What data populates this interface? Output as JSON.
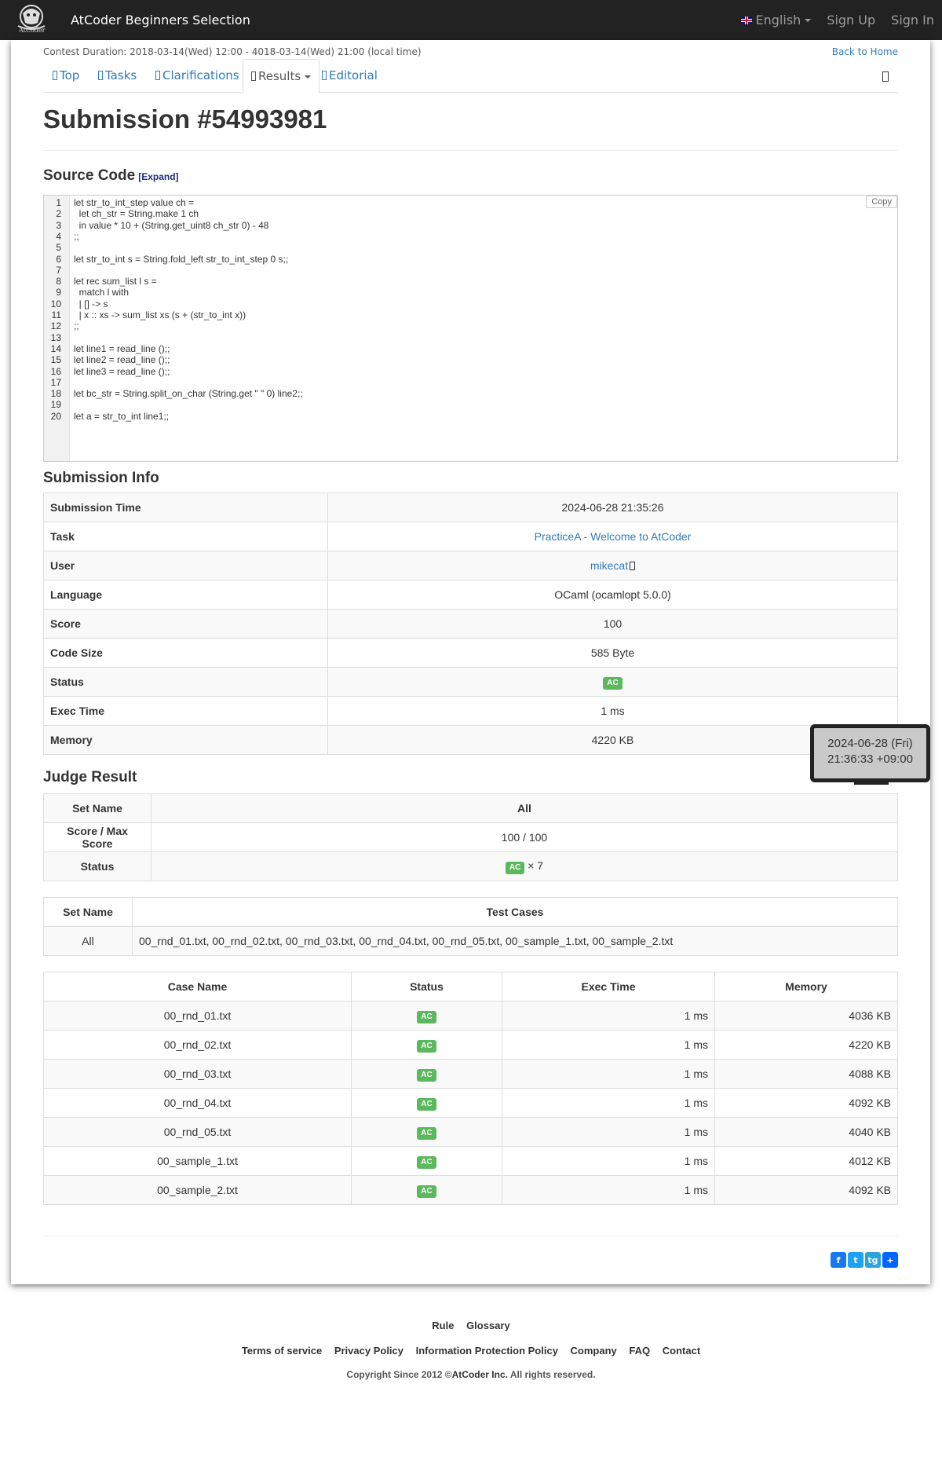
{
  "nav": {
    "brand": "AtCoder Beginners Selection",
    "logo_text": "AtCoder",
    "language": "English",
    "sign_up": "Sign Up",
    "sign_in": "Sign In"
  },
  "contest": {
    "duration": "Contest Duration: 2018-03-14(Wed) 12:00 - 4018-03-14(Wed) 21:00 (local time)",
    "back_home": "Back to Home"
  },
  "tabs": [
    {
      "label": "Top"
    },
    {
      "label": "Tasks"
    },
    {
      "label": "Clarifications"
    },
    {
      "label": "Results"
    },
    {
      "label": "Editorial"
    }
  ],
  "title": "Submission #54993981",
  "source": {
    "heading": "Source Code",
    "expand": "[Expand]",
    "copy": "Copy",
    "lines": [
      "let str_to_int_step value ch =",
      "  let ch_str = String.make 1 ch",
      "  in value * 10 + (String.get_uint8 ch_str 0) - 48",
      ";;",
      "",
      "let str_to_int s = String.fold_left str_to_int_step 0 s;;",
      "",
      "let rec sum_list l s =",
      "  match l with",
      "  | [] -> s",
      "  | x :: xs -> sum_list xs (s + (str_to_int x))",
      ";;",
      "",
      "let line1 = read_line ();;",
      "let line2 = read_line ();;",
      "let line3 = read_line ();;",
      "",
      "let bc_str = String.split_on_char (String.get \" \" 0) line2;;",
      "",
      "let a = str_to_int line1;;"
    ]
  },
  "info": {
    "heading": "Submission Info",
    "rows": [
      {
        "label": "Submission Time",
        "value": "2024-06-28 21:35:26"
      },
      {
        "label": "Task",
        "value": "PracticeA - Welcome to AtCoder"
      },
      {
        "label": "User",
        "value": "mikecat"
      },
      {
        "label": "Language",
        "value": "OCaml (ocamlopt 5.0.0)"
      },
      {
        "label": "Score",
        "value": "100"
      },
      {
        "label": "Code Size",
        "value": "585 Byte"
      },
      {
        "label": "Status",
        "value": "AC"
      },
      {
        "label": "Exec Time",
        "value": "1 ms"
      },
      {
        "label": "Memory",
        "value": "4220 KB"
      }
    ]
  },
  "tooltip": {
    "line1": "2024-06-28 (Fri)",
    "line2": "21:36:33 +09:00"
  },
  "judge": {
    "heading": "Judge Result",
    "set_name_label": "Set Name",
    "set_name": "All",
    "score_label": "Score / Max Score",
    "score": "100 / 100",
    "status_label": "Status",
    "status": "AC",
    "status_count": "× 7"
  },
  "testset": {
    "set_name_label": "Set Name",
    "test_cases_label": "Test Cases",
    "set_name": "All",
    "cases": "00_rnd_01.txt, 00_rnd_02.txt, 00_rnd_03.txt, 00_rnd_04.txt, 00_rnd_05.txt, 00_sample_1.txt, 00_sample_2.txt"
  },
  "cases": {
    "headers": [
      "Case Name",
      "Status",
      "Exec Time",
      "Memory"
    ],
    "rows": [
      {
        "name": "00_rnd_01.txt",
        "status": "AC",
        "time": "1 ms",
        "memory": "4036 KB"
      },
      {
        "name": "00_rnd_02.txt",
        "status": "AC",
        "time": "1 ms",
        "memory": "4220 KB"
      },
      {
        "name": "00_rnd_03.txt",
        "status": "AC",
        "time": "1 ms",
        "memory": "4088 KB"
      },
      {
        "name": "00_rnd_04.txt",
        "status": "AC",
        "time": "1 ms",
        "memory": "4092 KB"
      },
      {
        "name": "00_rnd_05.txt",
        "status": "AC",
        "time": "1 ms",
        "memory": "4040 KB"
      },
      {
        "name": "00_sample_1.txt",
        "status": "AC",
        "time": "1 ms",
        "memory": "4012 KB"
      },
      {
        "name": "00_sample_2.txt",
        "status": "AC",
        "time": "1 ms",
        "memory": "4092 KB"
      }
    ]
  },
  "share": [
    "f",
    "t",
    "tg",
    "+"
  ],
  "footer": {
    "rule": "Rule",
    "glossary": "Glossary",
    "terms": "Terms of service",
    "privacy": "Privacy Policy",
    "info_protection": "Information Protection Policy",
    "company": "Company",
    "faq": "FAQ",
    "contact": "Contact",
    "copyright_prefix": "Copyright Since 2012 ©",
    "copyright_company": "AtCoder Inc.",
    "copyright_suffix": " All rights reserved."
  },
  "colors": {
    "navbar": "#222222",
    "link": "#337ab7",
    "ac": "#5cb85c"
  }
}
